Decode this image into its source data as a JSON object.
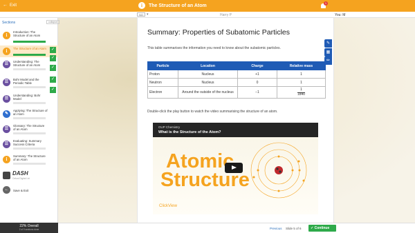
{
  "topbar": {
    "exit_label": "Exit",
    "title": "The Structure of an Atom",
    "notif_count": "1"
  },
  "subbar": {
    "selector_box": "NO",
    "user": "Harry P",
    "you_label": "You: M"
  },
  "sidebar": {
    "heading": "Sections",
    "collapse_label": "collapse",
    "items": [
      {
        "label": "Introduction: The Structure of an Atom",
        "icon": "info-icon",
        "state": "done"
      },
      {
        "label": "The Structure of an Atom",
        "icon": "info-icon",
        "state": "active"
      },
      {
        "label": "Understanding: The Structure of an Atom",
        "icon": "list-icon",
        "state": "done"
      },
      {
        "label": "Bohr Model and the Periodic Table",
        "icon": "list-icon",
        "state": "done"
      },
      {
        "label": "Understanding: Bohr Model",
        "icon": "list-icon",
        "state": "done"
      },
      {
        "label": "Applying: The Structure of an Atom",
        "icon": "pencil-icon",
        "state": "done"
      },
      {
        "label": "Glossary: The Structure of an Atom",
        "icon": "list-icon",
        "state": ""
      },
      {
        "label": "Evaluating: Summary Success Criteria",
        "icon": "list-icon",
        "state": ""
      },
      {
        "label": "Summary: The Structure of an Atom",
        "icon": "info-icon",
        "state": ""
      }
    ],
    "logo_name": "DASH",
    "logo_sub": "Oxford Digital Ltd",
    "save_exit": "Save & Exit",
    "overall_pct": "22% Overall",
    "overall_sub": "2 of 9 sections done"
  },
  "content": {
    "heading": "Summary: Properties of Subatomic Particles",
    "intro": "This table summarises the information you need to know about the subatomic particles.",
    "table": {
      "headers": [
        "Particle",
        "Location",
        "Charge",
        "Relative mass"
      ],
      "rows": [
        [
          "Proton",
          "Nucleus",
          "+1",
          "1"
        ],
        [
          "Neutron",
          "Nucleus",
          "0",
          "1"
        ],
        [
          "Electron",
          "Around the outside of the nucleus",
          "−1",
          "1",
          "1840"
        ]
      ]
    },
    "video_note": "Double-click the play button to watch the video summarising the structure of an atom.",
    "video": {
      "brand": "OUP Chemistry",
      "title": "What is the Structure of the Atom?",
      "big_line1": "Atomic",
      "big_line2": "Structure",
      "clickview": "ClickView"
    }
  },
  "bottom": {
    "previous": "Previous",
    "slide": "Slide 5 of 6",
    "continue": "Continue"
  },
  "colors": {
    "accent": "#f5a31f",
    "blue": "#1f5bb5",
    "green": "#2eaa4a"
  }
}
